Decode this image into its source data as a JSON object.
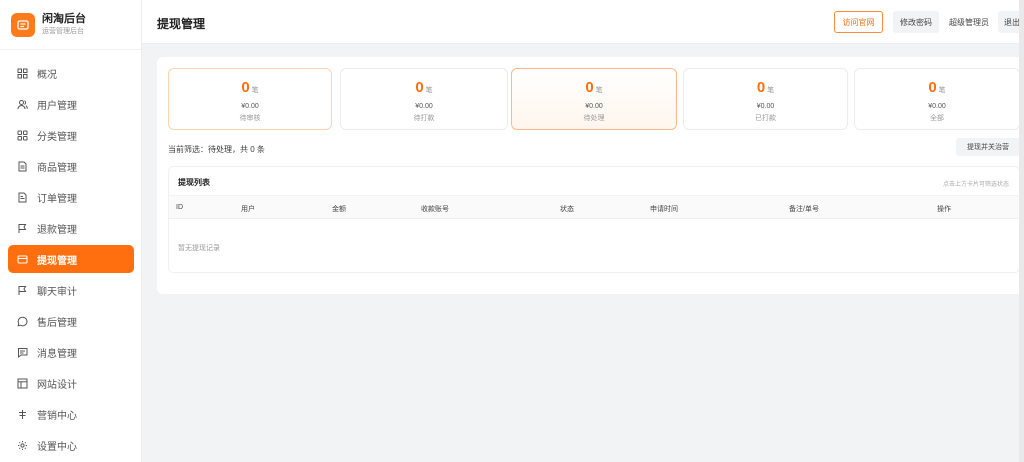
{
  "brand": {
    "title": "闲淘后台",
    "subtitle": "运营管理后台"
  },
  "sidebar": {
    "items": [
      {
        "label": "概况",
        "icon": "grid-icon"
      },
      {
        "label": "用户管理",
        "icon": "users-icon"
      },
      {
        "label": "分类管理",
        "icon": "category-icon"
      },
      {
        "label": "商品管理",
        "icon": "document-icon"
      },
      {
        "label": "订单管理",
        "icon": "order-icon"
      },
      {
        "label": "退款管理",
        "icon": "flag-icon"
      },
      {
        "label": "提现管理",
        "icon": "card-icon",
        "active": true
      },
      {
        "label": "聊天审计",
        "icon": "flag-icon"
      },
      {
        "label": "售后管理",
        "icon": "chat-icon"
      },
      {
        "label": "消息管理",
        "icon": "message-icon"
      },
      {
        "label": "网站设计",
        "icon": "layout-icon"
      },
      {
        "label": "营销中心",
        "icon": "marketing-icon"
      },
      {
        "label": "设置中心",
        "icon": "gear-icon"
      }
    ]
  },
  "header": {
    "title": "提现管理",
    "visit_label": "访问官网",
    "change_password_label": "修改密码",
    "role_label": "超级管理员",
    "logout_label": "退出"
  },
  "stats": [
    {
      "count": "0",
      "unit": "笔",
      "amount": "¥0.00",
      "label": "待审核"
    },
    {
      "count": "0",
      "unit": "笔",
      "amount": "¥0.00",
      "label": "待打款"
    },
    {
      "count": "0",
      "unit": "笔",
      "amount": "¥0.00",
      "label": "待处理",
      "selected": true
    },
    {
      "count": "0",
      "unit": "笔",
      "amount": "¥0.00",
      "label": "已打款"
    },
    {
      "count": "0",
      "unit": "笔",
      "amount": "¥0.00",
      "label": "全部"
    }
  ],
  "filter": {
    "prefix": "当前筛选：",
    "value": "待处理",
    "suffix": "，共 0 条"
  },
  "export_label": "提现并关治营",
  "list": {
    "title": "提现列表",
    "hint": "点击上方卡片可筛选状态",
    "columns": [
      "ID",
      "用户",
      "金额",
      "收款账号",
      "状态",
      "申请时间",
      "备注/单号",
      "操作"
    ],
    "empty_text": "暂无提现记录"
  },
  "colors": {
    "accent": "#ff6f0f",
    "accent_border": "#ffb887",
    "background": "#f2f3f5"
  }
}
